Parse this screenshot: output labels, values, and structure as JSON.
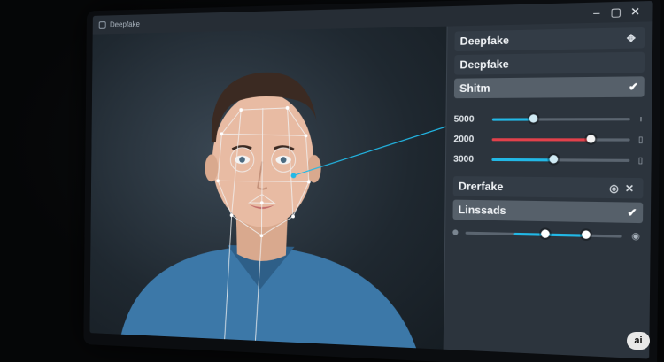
{
  "window": {
    "title": "Deepfake"
  },
  "colors": {
    "accent_blue": "#22b8e6",
    "accent_red": "#e2414b",
    "face_mesh": "#f2f2f2"
  },
  "panel": {
    "header1": "Deepfake",
    "header2": "Deepfake",
    "dropdown": "Shitm",
    "sliders": [
      {
        "value_label": "5000",
        "level": 0.3,
        "color": "#22b8e6"
      },
      {
        "value_label": "2000",
        "level": 0.72,
        "color": "#e2414b"
      },
      {
        "value_label": "3000",
        "level": 0.45,
        "color": "#22b8e6"
      }
    ],
    "section_title": "Drerfake",
    "section_sub": "Linssads",
    "mini_slider": {
      "low": 0.52,
      "high": 0.78
    }
  },
  "badge": "ai"
}
